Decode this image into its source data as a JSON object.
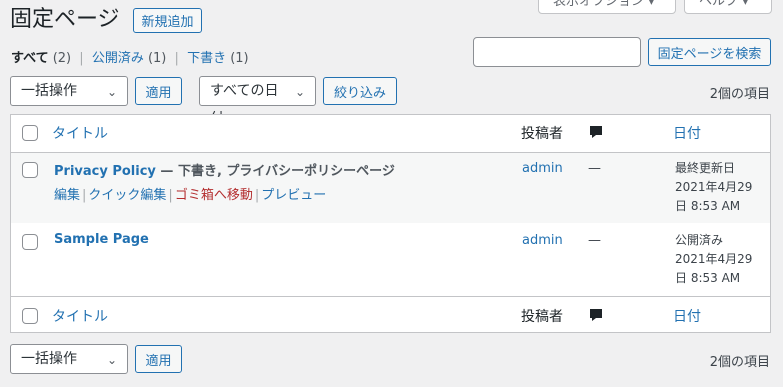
{
  "screen_options": {
    "display_options_label": "表示オプション ▾",
    "help_label": "ヘルプ ▾"
  },
  "page": {
    "title": "固定ページ",
    "add_new_label": "新規追加"
  },
  "filters": {
    "all_label": "すべて",
    "all_count": "(2)",
    "published_label": "公開済み",
    "published_count": "(1)",
    "draft_label": "下書き",
    "draft_count": "(1)",
    "separator": "|"
  },
  "search": {
    "input_value": "",
    "button_label": "固定ページを検索"
  },
  "top_nav": {
    "bulk_action": "一括操作",
    "apply_label": "適用",
    "date_filter": "すべての日付",
    "filter_label": "絞り込み",
    "items_count": "2個の項目"
  },
  "bottom_nav": {
    "bulk_action": "一括操作",
    "apply_label": "適用",
    "items_count": "2個の項目"
  },
  "table": {
    "columns": {
      "title": "タイトル",
      "author": "投稿者",
      "comments_icon": "comment-bubble-icon",
      "date": "日付"
    },
    "rows": [
      {
        "title": "Privacy Policy",
        "state": " — 下書き, プライバシーポリシーページ",
        "actions": {
          "edit": "編集",
          "quick_edit": "クイック編集",
          "trash": "ゴミ箱へ移動",
          "preview": "プレビュー",
          "separator": "|"
        },
        "author": "admin",
        "comments": "—",
        "date_status": "最終更新日",
        "date_line1": "2021年4月29",
        "date_line2": "日 8:53 AM"
      },
      {
        "title": "Sample Page",
        "author": "admin",
        "comments": "—",
        "date_status": "公開済み",
        "date_line1": "2021年4月29",
        "date_line2": "日 8:53 AM"
      }
    ]
  },
  "colors": {
    "link": "#2271b1",
    "trash": "#b32d2e",
    "background": "#f0f0f1",
    "border": "#c3c4c7"
  }
}
